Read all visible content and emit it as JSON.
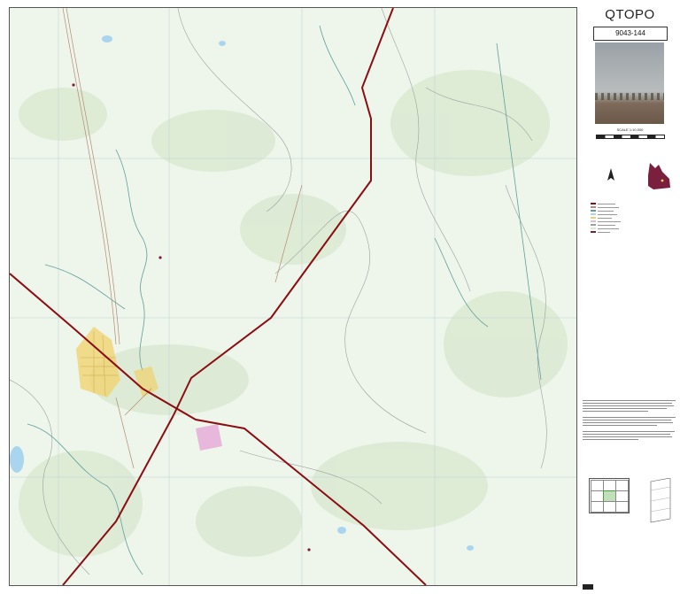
{
  "map": {
    "sheet_title": "QTOPO",
    "sheet_number": "9043-144",
    "scale_text": "SCALE 1:10,000",
    "colors": {
      "background": "#eef5ea",
      "road": "#8b0d12",
      "watercourse": "#5f9ea0",
      "contour": "#9aa0a0",
      "lake": "#a9d6ee",
      "town": "#f0d16a",
      "area_pink": "#e7b8dc",
      "vegetation": "#d9ead1",
      "queensland": "#7a1f3d"
    },
    "icons": [
      "qld-locator-map",
      "north-arrow-icon",
      "photo-thumbnail"
    ]
  }
}
